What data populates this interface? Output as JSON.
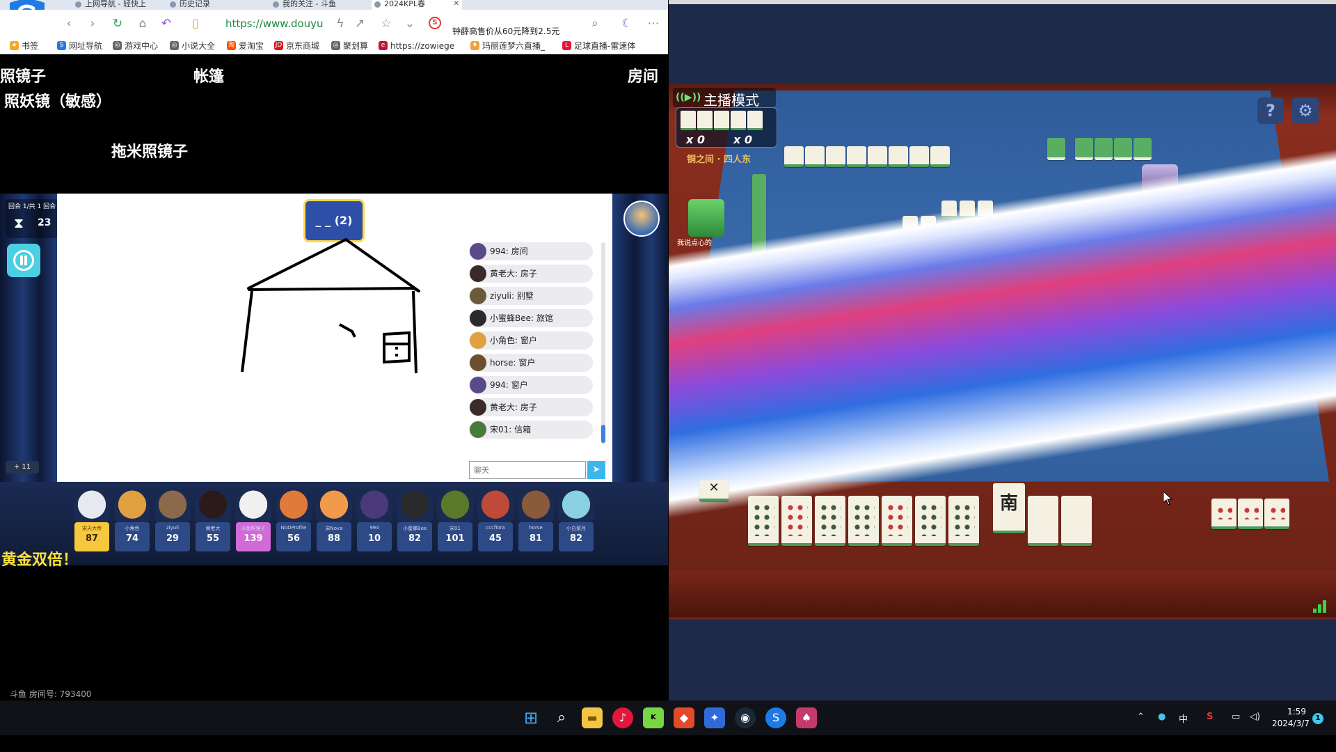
{
  "browser": {
    "tabs": [
      {
        "label": "上网导航 - 轻快上"
      },
      {
        "label": "历史记录"
      },
      {
        "label": "我的关注 - 斗鱼"
      },
      {
        "label": "2024KPL春"
      }
    ],
    "url": "https://www.douyu",
    "news_ticker": "钟薛高售价从60元降到2.5元",
    "bookmarks": [
      {
        "label": "书签"
      },
      {
        "label": "网址导航"
      },
      {
        "label": "游戏中心"
      },
      {
        "label": "小说大全"
      },
      {
        "label": "爱淘宝"
      },
      {
        "label": "京东商城"
      },
      {
        "label": "聚划算"
      },
      {
        "label": "https://zowiege"
      },
      {
        "label": "玛丽莲梦六直播_"
      },
      {
        "label": "足球直播-雷速体"
      }
    ]
  },
  "stream": {
    "words": {
      "top_left": "照镜子",
      "top_center": "帐篷",
      "top_right": "房间",
      "sub_left": "照妖镜（敏感）",
      "center": "拖米照镜子"
    },
    "game": {
      "round_label": "回合 1/共 1 回合",
      "timer": "23",
      "hint": "_ _ (2)",
      "plus_badge": "+ 11",
      "chat_placeholder": "聊天",
      "chat": [
        {
          "text": "994: 房间",
          "color": "#5a4a8a"
        },
        {
          "text": "黄老大: 房子",
          "color": "#3a2a2a"
        },
        {
          "text": "ziyuli: 别墅",
          "color": "#6b5a3a"
        },
        {
          "text": "小蜜蜂Bee: 旅馆",
          "color": "#2a2a2a"
        },
        {
          "text": "小角色: 窗户",
          "color": "#e0a040"
        },
        {
          "text": "horse: 窗户",
          "color": "#6a5030"
        },
        {
          "text": "994: 窗户",
          "color": "#5a4a8a"
        },
        {
          "text": "黄老大: 房子",
          "color": "#3a2a2a"
        },
        {
          "text": "宋01: 信箱",
          "color": "#4a7a3a"
        }
      ],
      "players": [
        {
          "name": "宋天大帝",
          "score": "87",
          "style": "gold",
          "color": "#e8e8f0"
        },
        {
          "name": "小角色",
          "score": "74",
          "style": "",
          "color": "#e0a040"
        },
        {
          "name": "ziyuli",
          "score": "29",
          "style": "",
          "color": "#8a6a4a"
        },
        {
          "name": "黄老大",
          "score": "55",
          "style": "",
          "color": "#2a1a1a"
        },
        {
          "name": "斗鱼照镜子",
          "score": "139",
          "style": "pink",
          "color": "#f0f0f0"
        },
        {
          "name": "NoDProfile",
          "score": "56",
          "style": "",
          "color": "#e07a3a"
        },
        {
          "name": "宋Nova",
          "score": "88",
          "style": "",
          "color": "#f09a4a"
        },
        {
          "name": "994",
          "score": "10",
          "style": "",
          "color": "#4a3a7a"
        },
        {
          "name": "小蜜蜂Bee",
          "score": "82",
          "style": "",
          "color": "#2a2a2a"
        },
        {
          "name": "宋01",
          "score": "101",
          "style": "",
          "color": "#5a7a2a"
        },
        {
          "name": "cccflora",
          "score": "45",
          "style": "",
          "color": "#c04a3a"
        },
        {
          "name": "horse",
          "score": "81",
          "style": "",
          "color": "#8a5a3a"
        },
        {
          "name": "小白菜月",
          "score": "82",
          "style": "",
          "color": "#8ad0e0"
        }
      ],
      "gold_banner": "黄金双倍！"
    },
    "room_no": "斗鱼 房间号: 793400"
  },
  "mahjong": {
    "mode_label": "主播模式",
    "score_left": "x 0",
    "score_right": "x 0",
    "room_title": "铜之间 · 四人东",
    "opp_left_name": "我说点心的",
    "hand_glyph": "南"
  },
  "taskbar": {
    "tray_lang": "中",
    "time": "1:59",
    "date": "2024/3/7",
    "notif": "1"
  },
  "colors": {
    "felt": "#3c6fb0",
    "accent_green": "#37d44c",
    "gold": "#f7c83d"
  }
}
